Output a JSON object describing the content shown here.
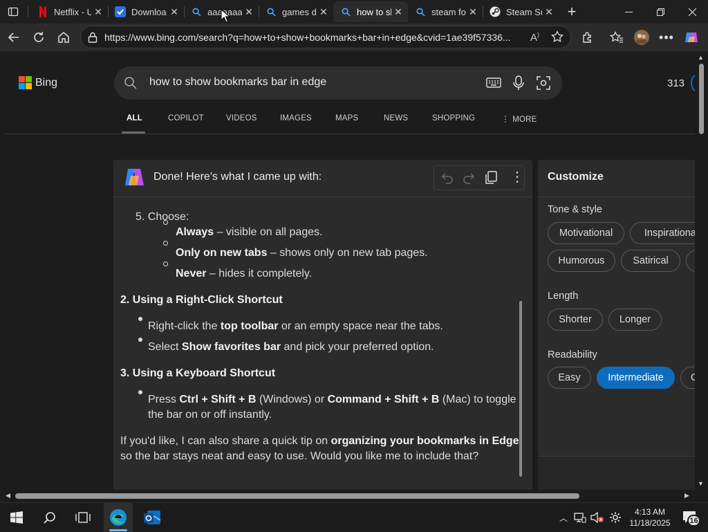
{
  "tabs": [
    {
      "label": "Netflix - U",
      "icon": "netflix-icon"
    },
    {
      "label": "Downloa",
      "icon": "downloads-icon"
    },
    {
      "label": "aaaaaaaa",
      "icon": "search-icon"
    },
    {
      "label": "games d",
      "icon": "search-icon"
    },
    {
      "label": "how to sl",
      "icon": "search-icon",
      "active": true
    },
    {
      "label": "steam fo",
      "icon": "search-icon"
    },
    {
      "label": "Steam Su",
      "icon": "steam-icon"
    }
  ],
  "address": {
    "url": "https://www.bing.com/search?q=how+to+show+bookmarks+bar+in+edge&cvid=1ae39f57336..."
  },
  "bing": {
    "logo": "Bing",
    "query": "how to show bookmarks bar in edge",
    "rewards": "313",
    "nav": [
      "ALL",
      "COPILOT",
      "VIDEOS",
      "IMAGES",
      "MAPS",
      "NEWS",
      "SHOPPING",
      "MORE"
    ]
  },
  "chat": {
    "header": "Done! Here's what I came up with:",
    "step5_num": "5.",
    "step5_label": "Choose:",
    "opt1_b": "Always",
    "opt1_t": " – visible on all pages.",
    "opt2_b": "Only on new tabs",
    "opt2_t": " – shows only on new tab pages.",
    "opt3_b": "Never",
    "opt3_t": " – hides it completely.",
    "h2": "2. Using a Right-Click Shortcut",
    "rc1_a": "Right-click the ",
    "rc1_b": "top toolbar",
    "rc1_c": " or an empty space near the tabs.",
    "rc2_a": "Select ",
    "rc2_b": "Show favorites bar",
    "rc2_c": " and pick your preferred option.",
    "h3": "3. Using a Keyboard Shortcut",
    "kb_a": "Press ",
    "kb_b": "Ctrl + Shift + B",
    "kb_c": " (Windows) or ",
    "kb_d": "Command + Shift + B",
    "kb_e": " (Mac) to toggle",
    "kb_f": "the bar on or off instantly.",
    "outro1_a": "If you'd like, I can also share a quick tip on ",
    "outro1_b": "organizing your bookmarks in Edge",
    "outro2": "so the bar stays neat and easy to use. Would you like me to include that?"
  },
  "customize": {
    "title": "Customize",
    "tone_label": "Tone & style",
    "tone_chips": [
      "Motivational",
      "Inspirational",
      "Humorous",
      "Satirical"
    ],
    "length_label": "Length",
    "length_chips": [
      "Shorter",
      "Longer"
    ],
    "readability_label": "Readability",
    "readability_chips": [
      "Easy",
      "Intermediate",
      "C"
    ],
    "readability_selected": "Intermediate"
  },
  "taskbar": {
    "time": "4:13 AM",
    "date": "11/18/2025",
    "notifications": "16"
  },
  "colors": {
    "accent": "#0f6cbd",
    "chrome_bg": "#2b2b2b",
    "page_bg": "#1c1c1c"
  }
}
